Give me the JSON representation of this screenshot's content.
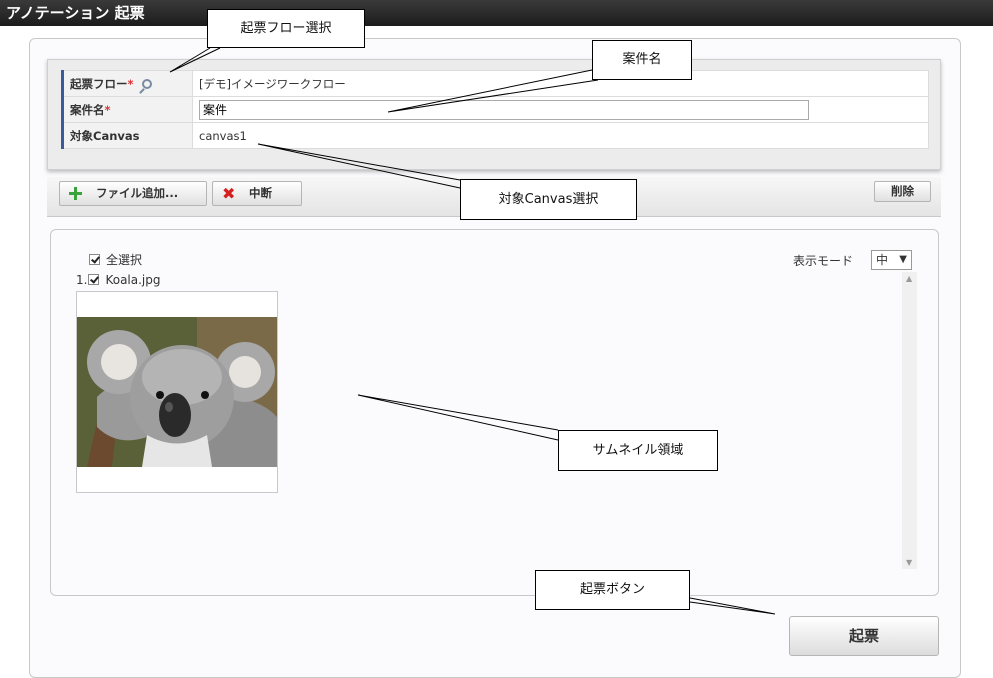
{
  "window": {
    "title": "アノテーション 起票"
  },
  "form": {
    "rows": [
      {
        "label": "起票フロー",
        "required": "*",
        "value": "[デモ]イメージワークフロー"
      },
      {
        "label": "案件名",
        "required": "*",
        "value": "案件"
      },
      {
        "label": "対象Canvas",
        "required": "",
        "value": "canvas1"
      }
    ]
  },
  "toolbar": {
    "add_file_label": "ファイル追加...",
    "abort_label": "中断",
    "delete_label": "削除"
  },
  "thumbnails": {
    "select_all_label": "全選択",
    "display_mode_label": "表示モード",
    "display_mode_value": "中",
    "items": [
      {
        "index": "1.",
        "filename": "Koala.jpg"
      }
    ]
  },
  "submit": {
    "label": "起票"
  },
  "callouts": {
    "flow_select": "起票フロー選択",
    "case_name": "案件名",
    "canvas_select": "対象Canvas選択",
    "thumbnail_area": "サムネイル領域",
    "submit_button": "起票ボタン"
  },
  "colors": {
    "titlebar": "#1c1c1c",
    "label_accent": "#3a5a9a",
    "required": "#dd3333",
    "add_icon": "#3aa33a",
    "abort_icon": "#d62020"
  }
}
